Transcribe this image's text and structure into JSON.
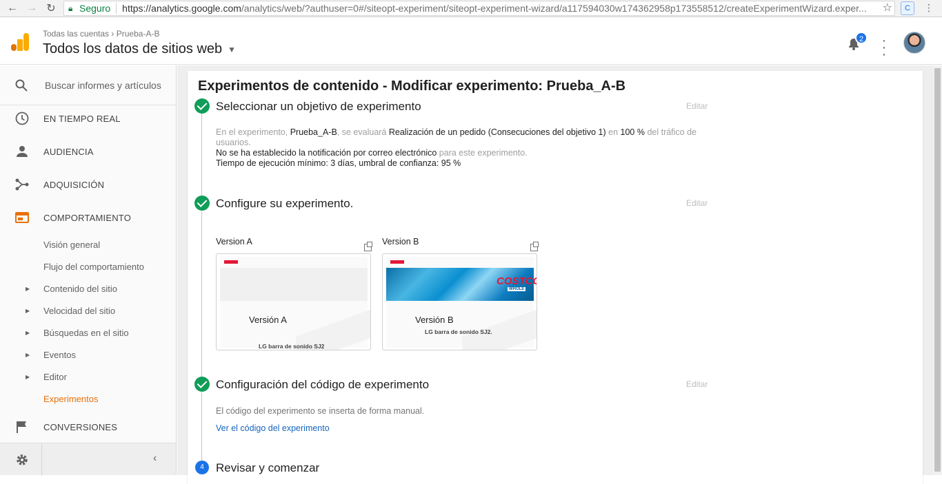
{
  "browser": {
    "secure_label": "Seguro",
    "url_host": "https://analytics.google.com",
    "url_path": "/analytics/web/?authuser=0#/siteopt-experiment/siteopt-experiment-wizard/a117594030w174362958p173558512/createExperimentWizard.exper..."
  },
  "header": {
    "breadcrumb_account": "Todas las cuentas",
    "breadcrumb_sep": "›",
    "breadcrumb_property": "Prueba-A-B",
    "view_name": "Todos los datos de sitios web",
    "notification_count": "2"
  },
  "sidebar": {
    "search_placeholder": "Buscar informes y artículos",
    "sections": [
      {
        "label": "EN TIEMPO REAL"
      },
      {
        "label": "AUDIENCIA"
      },
      {
        "label": "ADQUISICIÓN"
      },
      {
        "label": "COMPORTAMIENTO"
      }
    ],
    "behavior_items": [
      {
        "label": "Visión general"
      },
      {
        "label": "Flujo del comportamiento"
      },
      {
        "label": "Contenido del sitio"
      },
      {
        "label": "Velocidad del sitio"
      },
      {
        "label": "Búsquedas en el sitio"
      },
      {
        "label": "Eventos"
      },
      {
        "label": "Editor"
      },
      {
        "label": "Experimentos"
      }
    ],
    "conversions": "CONVERSIONES"
  },
  "wizard": {
    "title": "Experimentos de contenido - Modificar experimento: Prueba_A-B",
    "edit_label": "Editar",
    "step1": {
      "title": "Seleccionar un objetivo de experimento",
      "line1_a": "En el experimento, ",
      "line1_b": "Prueba_A-B",
      "line1_c": ", se evaluará ",
      "line1_d": "Realización de un pedido (Consecuciones del objetivo 1)",
      "line1_e": " en ",
      "line1_f": "100 %",
      "line1_g": " del tráfico de usuarios.",
      "line2_a": "No se ha establecido la notificación por correo electrónico",
      "line2_b": " para este experimento.",
      "line3": "Tiempo de ejecución mínimo: 3 días, umbral de confianza: 95 %"
    },
    "step2": {
      "title": "Configure su experimento.",
      "version_a_label": "Version A",
      "version_b_label": "Version B",
      "version_a_thumb": "Versión A",
      "version_b_thumb": "Versión B",
      "product_text": "LG barra de sonido SJ2.",
      "product_text_a": "LG barra de sonido SJ2",
      "brand_logo": "COSTCO",
      "brand_sub": "WHOLE"
    },
    "step3": {
      "title": "Configuración del código de experimento",
      "text": "El código del experimento se inserta de forma manual.",
      "link": "Ver el código del experimento"
    },
    "step4": {
      "number": "4",
      "title": "Revisar y comenzar"
    }
  },
  "colors": {
    "accent_orange": "#e8710a",
    "check_green": "#0f9d58",
    "step_blue": "#1a73e8",
    "link_blue": "#1565c0"
  }
}
